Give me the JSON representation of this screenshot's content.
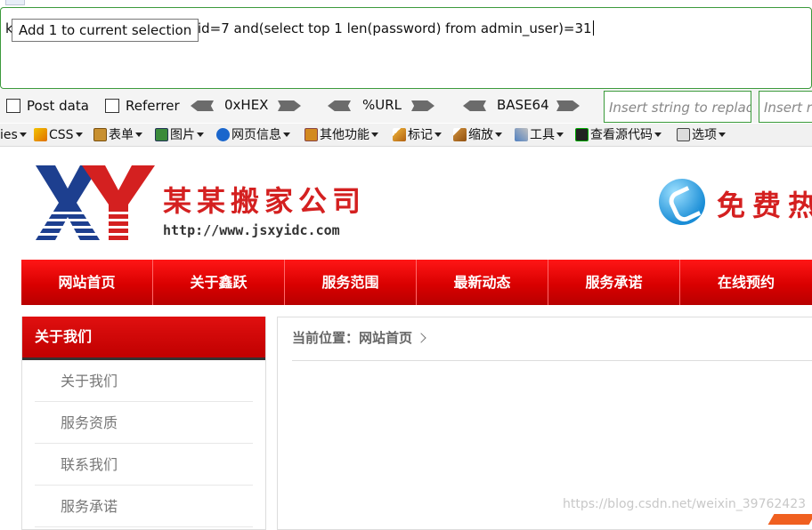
{
  "hackbar": {
    "url_prefix": "k",
    "url_text": "?id=7 and(select top 1 len(password) from admin_user)=31",
    "tooltip": "Add 1 to current selection",
    "options": {
      "post_data": "Post data",
      "referrer": "Referrer",
      "hex": "0xHEX",
      "url": "%URL",
      "base64": "BASE64",
      "insert_replace_placeholder": "Insert string to replace",
      "insert_replacing_placeholder": "Insert re"
    }
  },
  "webdev": {
    "items": [
      {
        "label": "ies",
        "icon": "cookie-icon"
      },
      {
        "label": "CSS",
        "icon": "css-icon"
      },
      {
        "label": "表单",
        "icon": "form-icon"
      },
      {
        "label": "图片",
        "icon": "image-icon"
      },
      {
        "label": "网页信息",
        "icon": "info-icon"
      },
      {
        "label": "其他功能",
        "icon": "misc-icon"
      },
      {
        "label": "标记",
        "icon": "outline-icon"
      },
      {
        "label": "缩放",
        "icon": "resize-icon"
      },
      {
        "label": "工具",
        "icon": "tools-icon"
      },
      {
        "label": "查看源代码",
        "icon": "source-icon"
      },
      {
        "label": "选项",
        "icon": "options-icon"
      }
    ]
  },
  "site": {
    "brand": "某某搬家公司",
    "domain": "http://www.jsxyidc.com",
    "hotline": "免费热",
    "nav": [
      "网站首页",
      "关于鑫跃",
      "服务范围",
      "最新动态",
      "服务承诺",
      "在线预约"
    ],
    "sidebar": {
      "title": "关于我们",
      "items": [
        "关于我们",
        "服务资质",
        "联系我们",
        "服务承诺"
      ]
    },
    "breadcrumb": "当前位置：网站首页",
    "watermark": "https://blog.csdn.net/weixin_39762423"
  },
  "colors": {
    "brand_red": "#d42020",
    "logo_blue": "#1d3f8f",
    "nav_red": "#d90000"
  }
}
